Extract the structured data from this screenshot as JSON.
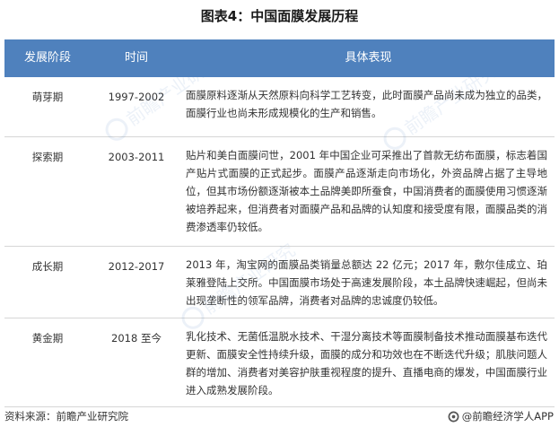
{
  "title": "图表4：中国面膜发展历程",
  "header_color": "#4f81bd",
  "table": {
    "headers": [
      "发展阶段",
      "时间",
      "具体表现"
    ],
    "rows": [
      {
        "stage": "萌芽期",
        "time": "1997-2002",
        "desc": "面膜原料逐渐从天然原料向科学工艺转变，此时面膜产品尚未成为独立的品类，面膜行业也尚未形成规模化的生产和销售。"
      },
      {
        "stage": "探索期",
        "time": "2003-2011",
        "desc": "贴片和美白面膜问世，2001 年中国企业可采推出了首款无纺布面膜，标志着国产贴片式面膜的正式起步。面膜产品逐渐走向市场化，外资品牌占据了主导地位，但其市场份额逐渐被本土品牌美即所蚕食，中国消费者的面膜使用习惯逐渐被培养起来，但消费者对面膜产品和品牌的认知度和接受度有限，面膜品类的消费渗透率仍较低。"
      },
      {
        "stage": "成长期",
        "time": "2012-2017",
        "desc": "2013 年，淘宝网的面膜品类销量总额达 22 亿元；2017 年，敷尔佳成立、珀莱雅登陆上交所。中国面膜市场处于高速发展阶段，本土品牌快速崛起，但尚未出现垄断性的领军品牌，消费者对品牌的忠诚度仍较低。"
      },
      {
        "stage": "黄金期",
        "time": "2018 至今",
        "desc": "乳化技术、无菌低温脱水技术、干湿分离技术等面膜制备技术推动面膜基布迭代更新、面膜安全性持续升级，面膜的成分和功效也在不断迭代升级；肌肤问题人群的增加、消费者对美容护肤重视程度的提升、直播电商的爆发，中国面膜行业进入成熟发展阶段。"
      }
    ]
  },
  "footer": {
    "source": "资料来源：前瞻产业研究院",
    "brand": "@前瞻经济学人APP"
  },
  "watermark": {
    "text": "前瞻产业研究院",
    "color": "#4f81bd"
  }
}
